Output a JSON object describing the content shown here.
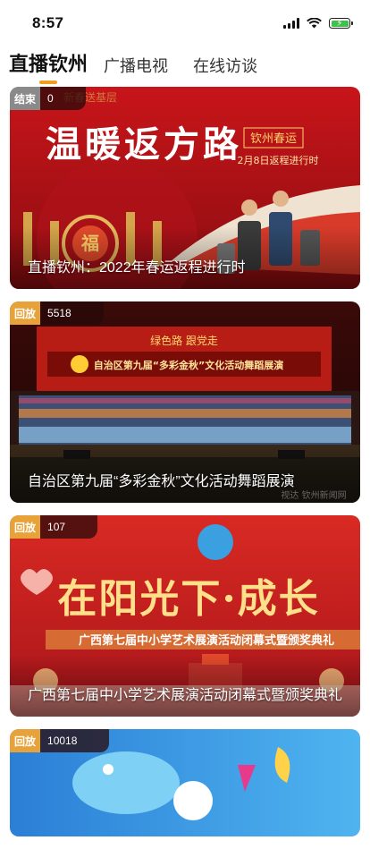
{
  "status_bar": {
    "time": "8:57"
  },
  "tabs": [
    {
      "label": "直播钦州",
      "active": true
    },
    {
      "label": "广播电视",
      "active": false
    },
    {
      "label": "在线访谈",
      "active": false
    }
  ],
  "cards": [
    {
      "status": "结束",
      "views": "0",
      "caption": "直播钦州：2022年春运返程进行时",
      "banner_title": "温暖返方路",
      "banner_tag": "钦州春运",
      "banner_sub": "2月8日返程进行时",
      "overlay_text": "新春送基层"
    },
    {
      "status": "回放",
      "views": "5518",
      "caption": "自治区第九届“多彩金秋”文化活动舞蹈展演",
      "stage_slogan_left": "绿色路",
      "stage_slogan_right": "跟党走",
      "stage_banner": "自治区第九届“多彩金秋”文化活动舞蹈展演",
      "watermark": "视达 钦州新闻网"
    },
    {
      "status": "回放",
      "views": "107",
      "caption": "广西第七届中小学艺术展演活动闭幕式暨颁奖典礼",
      "banner_title": "在阳光下·成长",
      "banner_sub": "广西第七届中小学艺术展演活动闭幕式暨颁奖典礼"
    },
    {
      "status": "回放",
      "views": "10018",
      "caption": ""
    }
  ]
}
